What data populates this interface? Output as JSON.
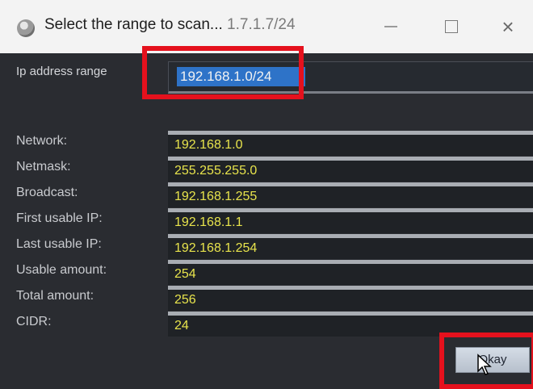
{
  "window": {
    "title_prefix": "Select the range to scan...",
    "title_ip": " 1.7.1.7/24",
    "minimize_label": "—",
    "close_label": "×"
  },
  "ip_range": {
    "label": "Ip address range",
    "value": "192.168.1.0/24"
  },
  "fields": [
    {
      "label": "Network:",
      "value": "192.168.1.0"
    },
    {
      "label": "Netmask:",
      "value": "255.255.255.0"
    },
    {
      "label": "Broadcast:",
      "value": "192.168.1.255"
    },
    {
      "label": "First usable IP:",
      "value": "192.168.1.1"
    },
    {
      "label": "Last usable IP:",
      "value": "192.168.1.254"
    },
    {
      "label": "Usable amount:",
      "value": "254"
    },
    {
      "label": "Total amount:",
      "value": "256"
    },
    {
      "label": "CIDR:",
      "value": "24"
    }
  ],
  "buttons": {
    "okay_label": "Okay"
  },
  "colors": {
    "highlight": "#e5111d",
    "field_text": "#e8e44c",
    "selection": "#2e73c8",
    "background": "#2a2c31"
  },
  "icons": [
    "app-globe-icon",
    "mouse-cursor-icon"
  ]
}
